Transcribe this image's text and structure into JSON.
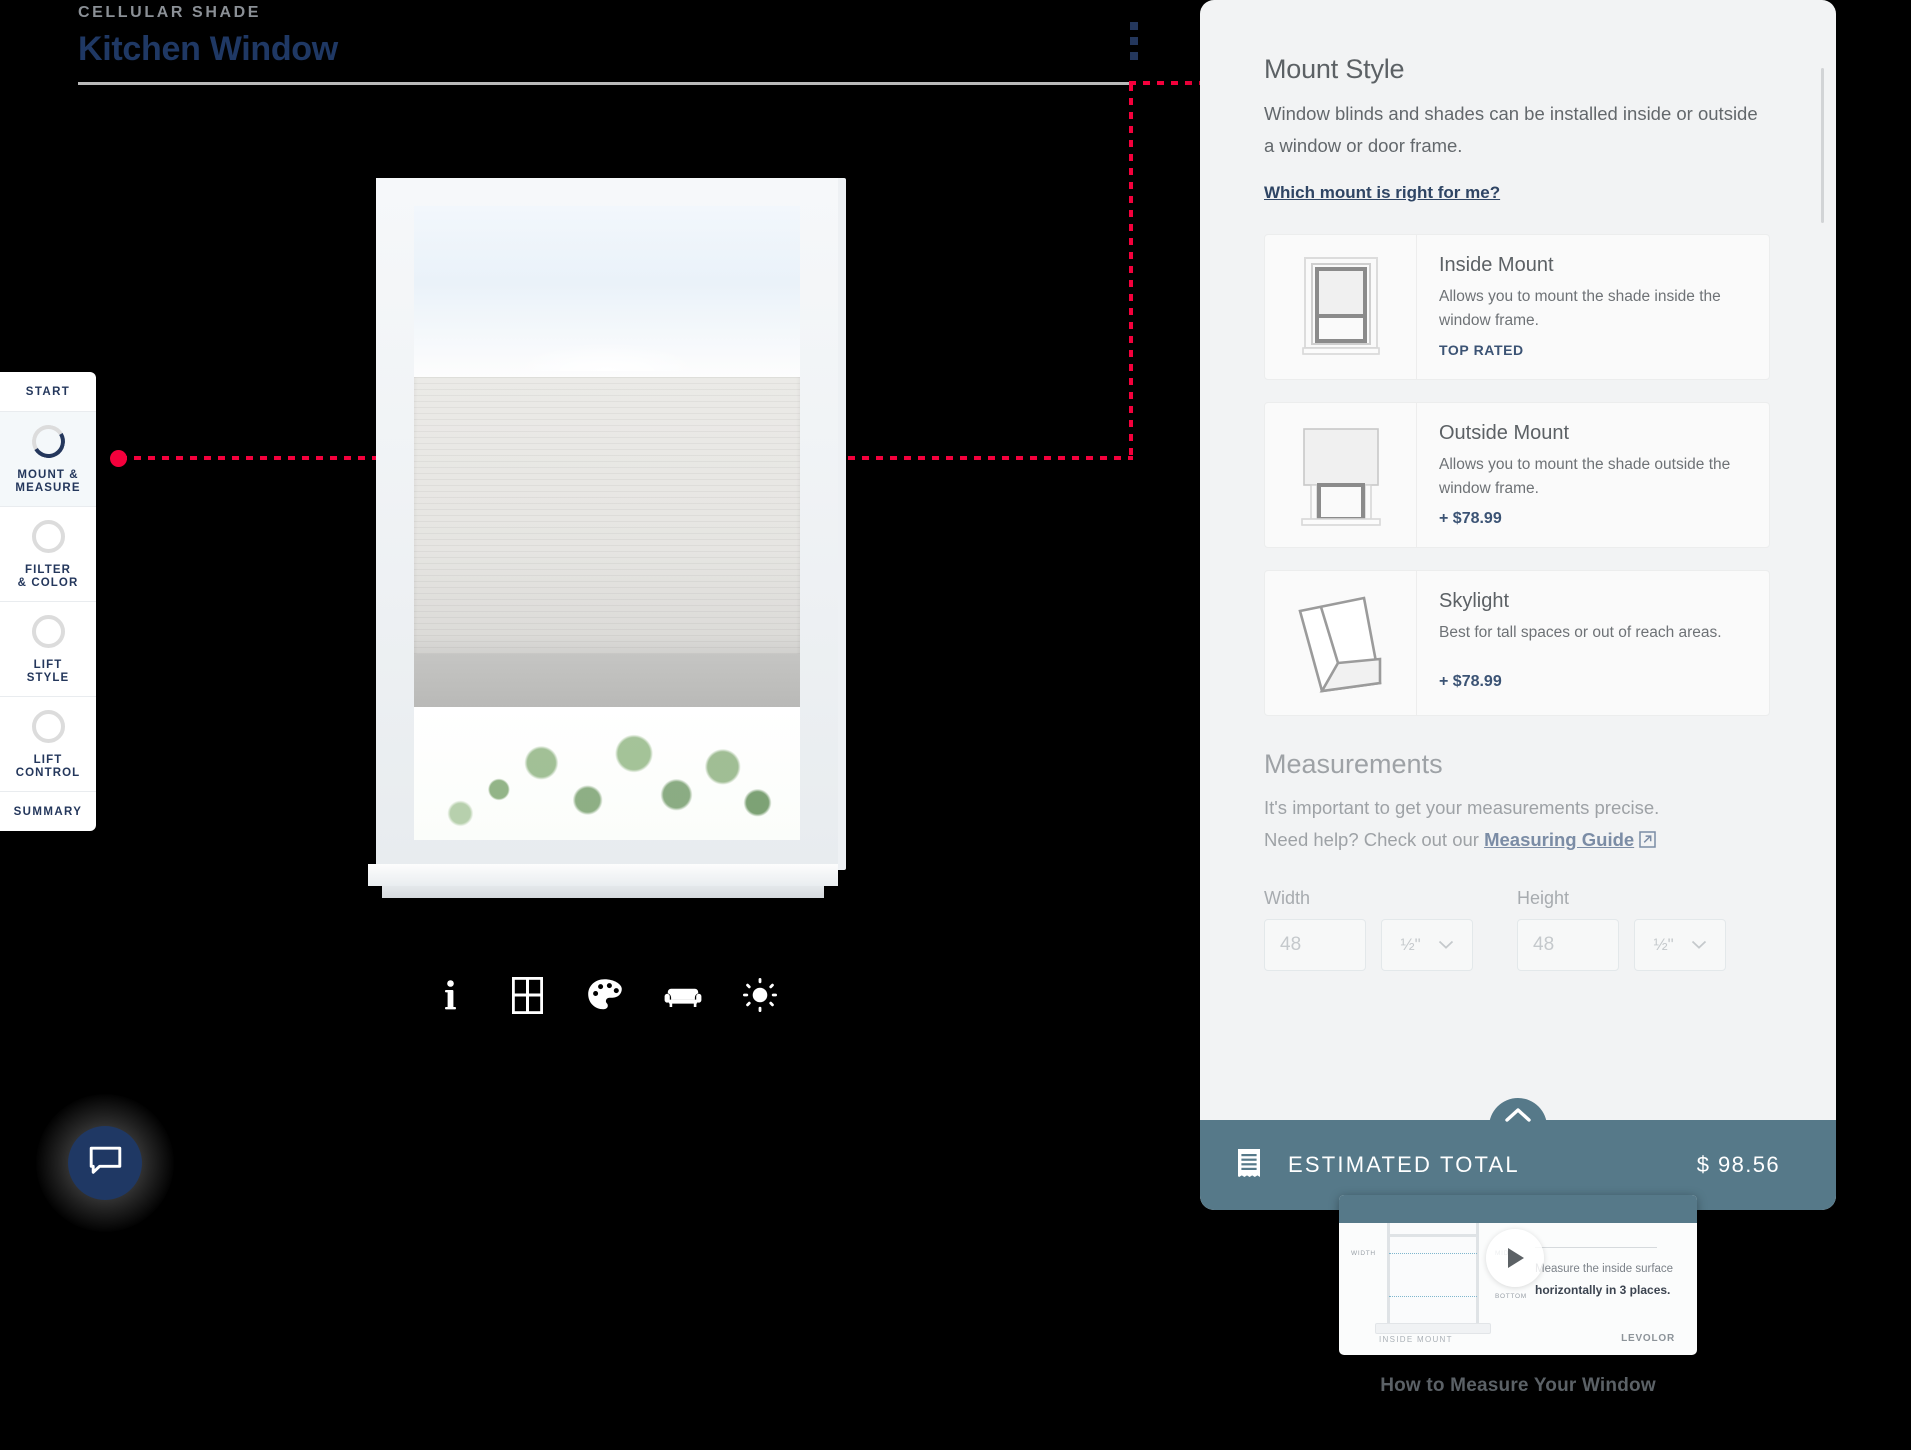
{
  "header": {
    "eyebrow": "CELLULAR SHADE",
    "title": "Kitchen Window",
    "menu_icon": "kebab-menu-icon"
  },
  "sidebar": {
    "start_label": "START",
    "summary_label": "SUMMARY",
    "items": [
      {
        "label_line1": "MOUNT &",
        "label_line2": "MEASURE",
        "active": true
      },
      {
        "label_line1": "FILTER",
        "label_line2": "& COLOR",
        "active": false
      },
      {
        "label_line1": "LIFT",
        "label_line2": "STYLE",
        "active": false
      },
      {
        "label_line1": "LIFT",
        "label_line2": "CONTROL",
        "active": false
      }
    ]
  },
  "toolbar": {
    "icons": [
      "info-icon",
      "window-grid-icon",
      "palette-icon",
      "sofa-icon",
      "brightness-icon"
    ]
  },
  "chat": {
    "icon": "chat-bubble-icon"
  },
  "panel": {
    "title": "Mount Style",
    "description": "Window blinds and shades can be installed inside or outside a window or door frame.",
    "help_link": "Which mount is right for me?",
    "options": [
      {
        "name": "Inside Mount",
        "description": "Allows you to mount the shade inside the window frame.",
        "tag": "TOP RATED",
        "price": "",
        "icon": "inside-mount-icon"
      },
      {
        "name": "Outside Mount",
        "description": "Allows you to mount the shade outside the window frame.",
        "tag": "",
        "price": "+ $78.99",
        "icon": "outside-mount-icon"
      },
      {
        "name": "Skylight",
        "description": "Best for tall spaces or out of reach areas.",
        "tag": "",
        "price": "+ $78.99",
        "icon": "skylight-icon"
      }
    ],
    "measurements": {
      "title": "Measurements",
      "intro_line1": "It's important to get your measurements precise.",
      "intro_line2_prefix": "Need help? Check out our ",
      "guide_link": "Measuring Guide",
      "width_label": "Width",
      "height_label": "Height",
      "width_value": "48",
      "height_value": "48",
      "width_fraction": "½\"",
      "height_fraction": "½\"",
      "fraction_icon": "chevron-down-icon"
    },
    "total": {
      "receipt_icon": "receipt-icon",
      "label": "ESTIMATED TOTAL",
      "amount": "$ 98.56",
      "expand_icon": "chevron-up-icon"
    }
  },
  "video": {
    "caption": "How to Measure Your Window",
    "play_icon": "play-icon",
    "overlay_text_line1": "Measure the inside surface",
    "overlay_text_line2": "horizontally in 3 places.",
    "label_width": "WIDTH",
    "label_mid": "MID",
    "label_bottom": "BOTTOM",
    "footer_left": "INSIDE MOUNT",
    "footer_right": "LEVOLOR"
  },
  "colors": {
    "brand_navy": "#1f3864",
    "accent_red": "#f5003c",
    "total_bar": "#567989",
    "link_blue": "#2f4564"
  }
}
